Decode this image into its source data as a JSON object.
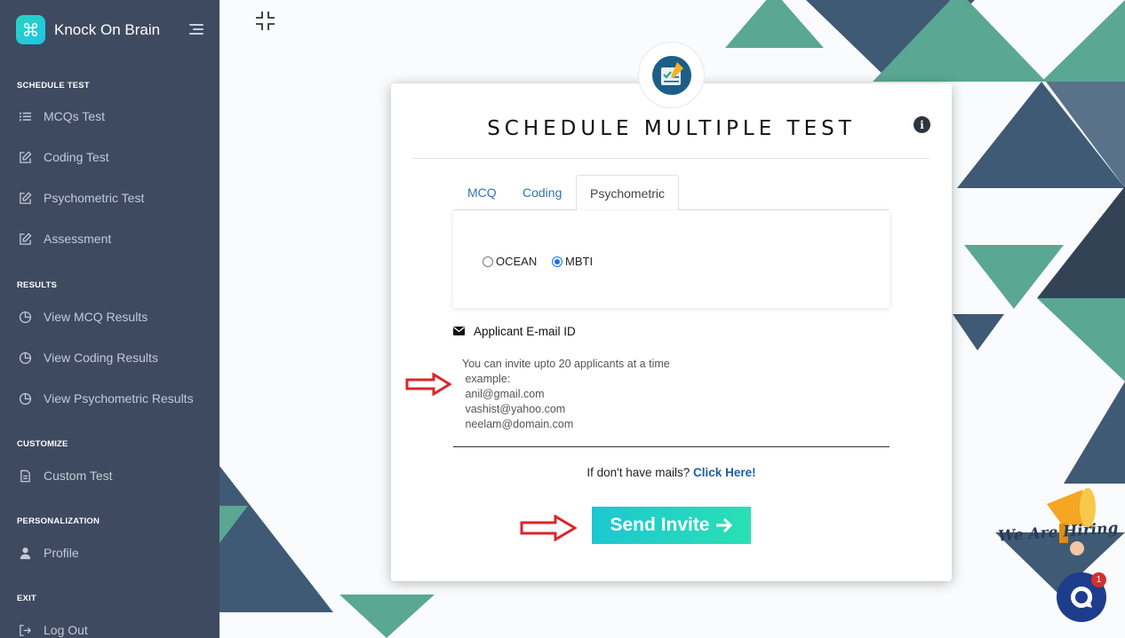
{
  "brand": {
    "name": "Knock On Brain",
    "logo_glyph": "⌘"
  },
  "colors": {
    "sidebar": "#3d4a60",
    "accent_teal": "#5aa793",
    "accent_dark": "#3f5a74",
    "button_start": "#1cc7d0",
    "button_end": "#2ae0b5",
    "link": "#1d5fa8",
    "arrow_red": "#d9262c"
  },
  "sidebar": {
    "sections": [
      {
        "title": "SCHEDULE TEST",
        "items": [
          {
            "label": "MCQs Test",
            "icon": "list-icon"
          },
          {
            "label": "Coding Test",
            "icon": "edit-icon"
          },
          {
            "label": "Psychometric Test",
            "icon": "edit-icon"
          },
          {
            "label": "Assessment",
            "icon": "edit-icon"
          }
        ]
      },
      {
        "title": "RESULTS",
        "items": [
          {
            "label": "View MCQ Results",
            "icon": "pie-chart-icon"
          },
          {
            "label": "View Coding Results",
            "icon": "pie-chart-icon"
          },
          {
            "label": "View Psychometric Results",
            "icon": "pie-chart-icon"
          }
        ]
      },
      {
        "title": "CUSTOMIZE",
        "items": [
          {
            "label": "Custom Test",
            "icon": "document-icon"
          }
        ]
      },
      {
        "title": "PERSONALIZATION",
        "items": [
          {
            "label": "Profile",
            "icon": "user-icon"
          }
        ]
      },
      {
        "title": "EXIT",
        "items": [
          {
            "label": "Log Out",
            "icon": "logout-icon"
          }
        ]
      }
    ]
  },
  "card": {
    "title": "SCHEDULE MULTIPLE TEST",
    "tabs": [
      {
        "label": "MCQ",
        "active": false
      },
      {
        "label": "Coding",
        "active": false
      },
      {
        "label": "Psychometric",
        "active": true
      }
    ],
    "test_types": [
      {
        "label": "OCEAN",
        "checked": false
      },
      {
        "label": "MBTI",
        "checked": true
      }
    ],
    "email_label": "Applicant E-mail ID",
    "email_placeholder_lines": [
      "You can invite upto 20 applicants at a time",
      " example:",
      " anil@gmail.com",
      " vashist@yahoo.com",
      " neelam@domain.com"
    ],
    "no_mail_text": "If don't have mails?",
    "no_mail_link": "Click Here!",
    "send_button": "Send Invite"
  },
  "widgets": {
    "hiring_text": "We Are Hiring",
    "chat_unread": "1"
  }
}
